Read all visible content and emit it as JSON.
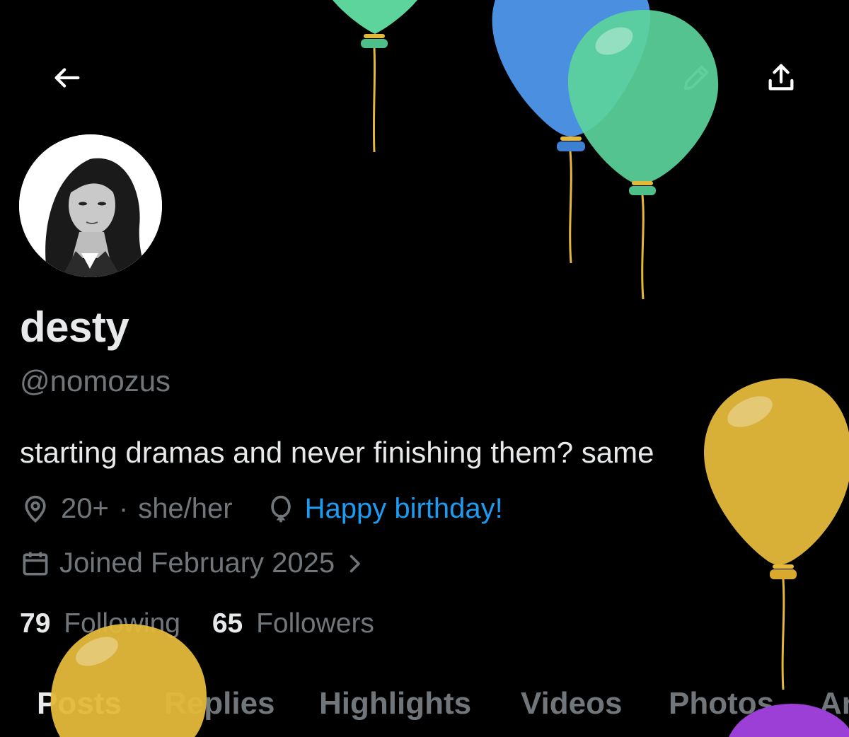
{
  "topbar": {
    "back_icon": "arrow-left-icon",
    "grok_icon": "grok-icon",
    "search_icon": "search-icon",
    "edit_icon": "pencil-icon",
    "share_icon": "share-icon"
  },
  "profile": {
    "display_name": "desty",
    "handle": "@nomozus",
    "bio": "starting dramas and never finishing them? same",
    "location": "20+",
    "separator": "·",
    "pronouns": "she/her",
    "birthday": "Happy birthday!",
    "joined": "Joined February 2025",
    "following_count": "79",
    "following_label": "Following",
    "followers_count": "65",
    "followers_label": "Followers"
  },
  "tabs": [
    "Posts",
    "Replies",
    "Highlights",
    "Videos",
    "Photos",
    "Ar"
  ],
  "colors": {
    "background": "#000000",
    "text_primary": "#e7e9ea",
    "text_secondary": "#71767b",
    "accent_blue": "#1d9bf0",
    "balloon_green": "#5cd49b",
    "balloon_blue": "#4a8fe0",
    "balloon_yellow": "#e4b93b",
    "balloon_purple": "#9b3fd6"
  }
}
